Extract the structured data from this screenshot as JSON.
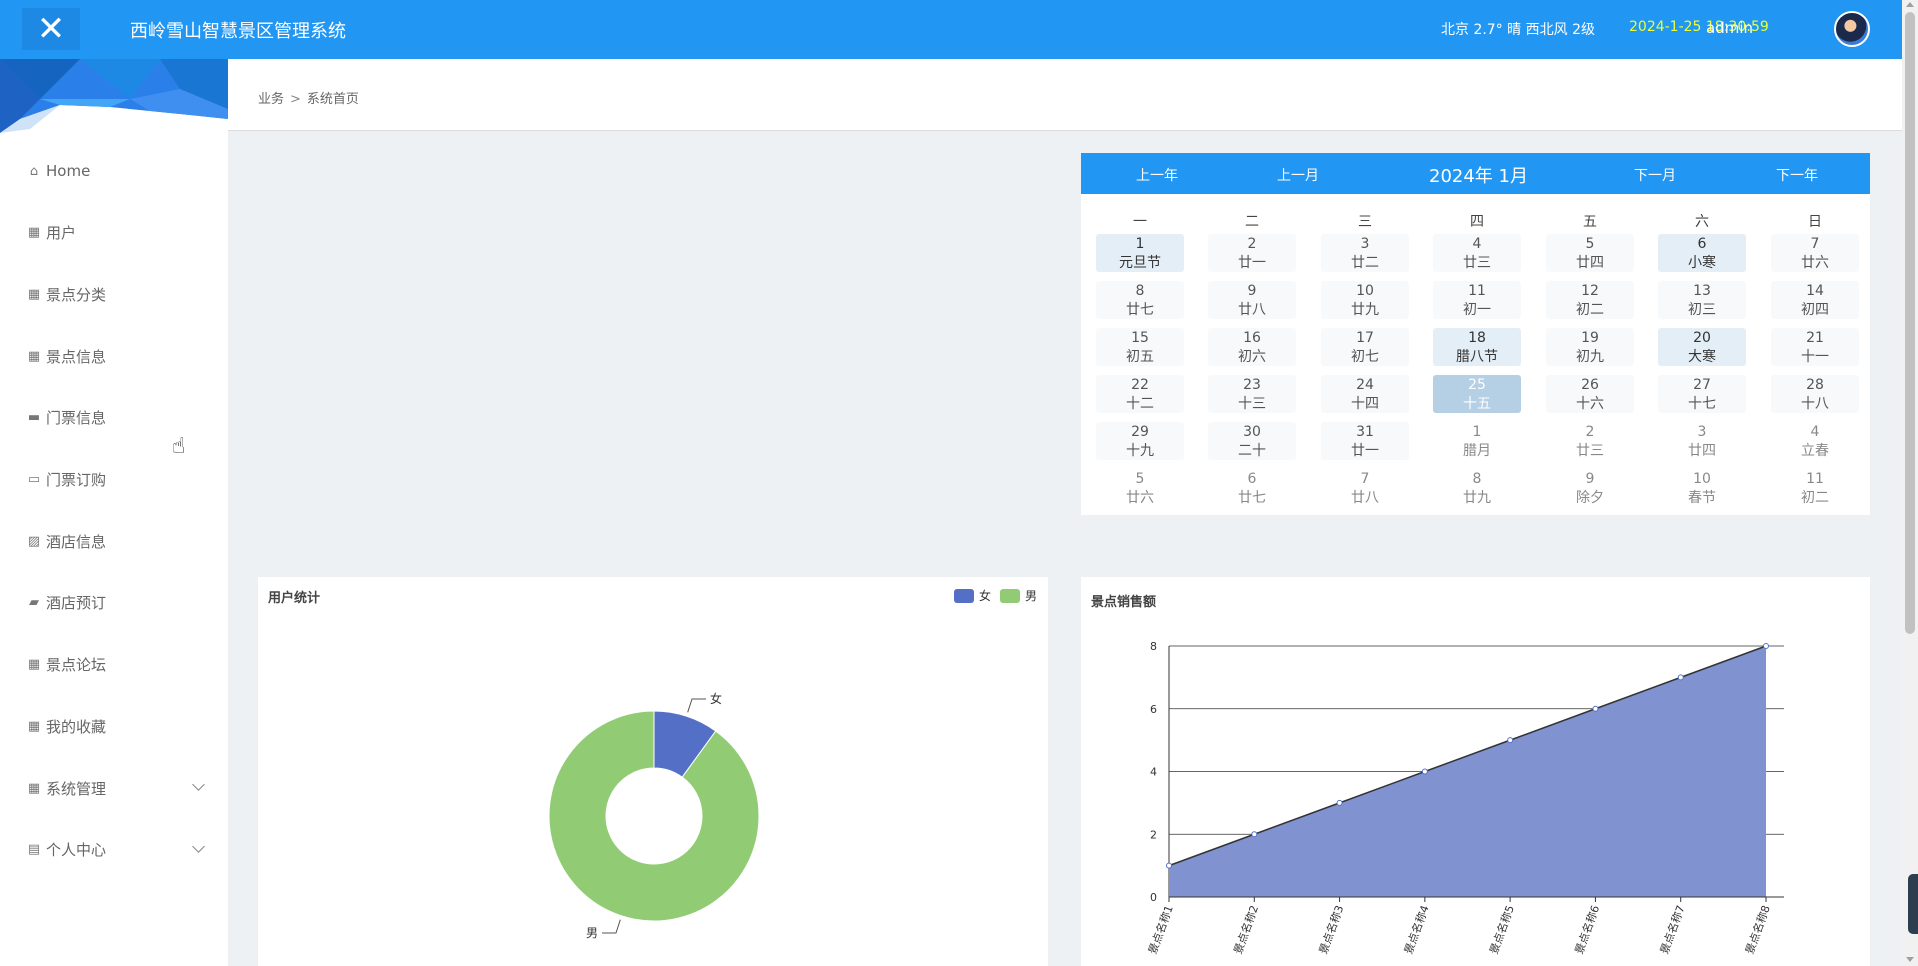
{
  "header": {
    "close_icon": "close-icon",
    "title": "西岭雪山智慧景区管理系统",
    "weather": "北京  2.7°  晴  西北风  2级",
    "datetime": "2024-1-25 18:30:59",
    "username": "admin",
    "colors": {
      "bar": "#2196f3",
      "datetime": "#e8ff3a"
    }
  },
  "sidebar": {
    "items": [
      {
        "label": "Home",
        "icon": "home-icon"
      },
      {
        "label": "用户",
        "icon": "grid-icon"
      },
      {
        "label": "景点分类",
        "icon": "grid-icon"
      },
      {
        "label": "景点信息",
        "icon": "grid-icon"
      },
      {
        "label": "门票信息",
        "icon": "briefcase-icon"
      },
      {
        "label": "门票订购",
        "icon": "bus-icon"
      },
      {
        "label": "酒店信息",
        "icon": "chart-icon"
      },
      {
        "label": "酒店预订",
        "icon": "camera-icon"
      },
      {
        "label": "景点论坛",
        "icon": "grid-icon"
      },
      {
        "label": "我的收藏",
        "icon": "grid-icon"
      },
      {
        "label": "系统管理",
        "icon": "grid-icon",
        "expandable": true
      },
      {
        "label": "个人中心",
        "icon": "card-icon",
        "expandable": true
      }
    ]
  },
  "breadcrumb": {
    "root": "业务",
    "separator": ">",
    "current": "系统首页"
  },
  "calendar": {
    "prev_year": "上一年",
    "prev_month": "上一月",
    "title": "2024年 1月",
    "next_month": "下一月",
    "next_year": "下一年",
    "weekdays": [
      "一",
      "二",
      "三",
      "四",
      "五",
      "六",
      "日"
    ],
    "days": [
      {
        "d": "1",
        "l": "元旦节",
        "s": "hl"
      },
      {
        "d": "2",
        "l": "廿一"
      },
      {
        "d": "3",
        "l": "廿二"
      },
      {
        "d": "4",
        "l": "廿三"
      },
      {
        "d": "5",
        "l": "廿四"
      },
      {
        "d": "6",
        "l": "小寒",
        "s": "hl"
      },
      {
        "d": "7",
        "l": "廿六"
      },
      {
        "d": "8",
        "l": "廿七"
      },
      {
        "d": "9",
        "l": "廿八"
      },
      {
        "d": "10",
        "l": "廿九"
      },
      {
        "d": "11",
        "l": "初一"
      },
      {
        "d": "12",
        "l": "初二"
      },
      {
        "d": "13",
        "l": "初三"
      },
      {
        "d": "14",
        "l": "初四"
      },
      {
        "d": "15",
        "l": "初五"
      },
      {
        "d": "16",
        "l": "初六"
      },
      {
        "d": "17",
        "l": "初七"
      },
      {
        "d": "18",
        "l": "腊八节",
        "s": "hl"
      },
      {
        "d": "19",
        "l": "初九"
      },
      {
        "d": "20",
        "l": "大寒",
        "s": "hl"
      },
      {
        "d": "21",
        "l": "十一"
      },
      {
        "d": "22",
        "l": "十二"
      },
      {
        "d": "23",
        "l": "十三"
      },
      {
        "d": "24",
        "l": "十四"
      },
      {
        "d": "25",
        "l": "十五",
        "s": "today"
      },
      {
        "d": "26",
        "l": "十六"
      },
      {
        "d": "27",
        "l": "十七"
      },
      {
        "d": "28",
        "l": "十八"
      },
      {
        "d": "29",
        "l": "十九"
      },
      {
        "d": "30",
        "l": "二十"
      },
      {
        "d": "31",
        "l": "廿一"
      },
      {
        "d": "1",
        "l": "腊月",
        "s": "other"
      },
      {
        "d": "2",
        "l": "廿三",
        "s": "other"
      },
      {
        "d": "3",
        "l": "廿四",
        "s": "other"
      },
      {
        "d": "4",
        "l": "立春",
        "s": "other"
      },
      {
        "d": "5",
        "l": "廿六",
        "s": "other"
      },
      {
        "d": "6",
        "l": "廿七",
        "s": "other"
      },
      {
        "d": "7",
        "l": "廿八",
        "s": "other"
      },
      {
        "d": "8",
        "l": "廿九",
        "s": "other"
      },
      {
        "d": "9",
        "l": "除夕",
        "s": "other"
      },
      {
        "d": "10",
        "l": "春节",
        "s": "other"
      },
      {
        "d": "11",
        "l": "初二",
        "s": "other"
      }
    ]
  },
  "user_stats": {
    "title": "用户统计",
    "legend": [
      "女",
      "男"
    ]
  },
  "sales": {
    "title": "景点销售额"
  },
  "chart_data": [
    {
      "type": "pie",
      "title": "用户统计",
      "categories": [
        "女",
        "男"
      ],
      "values": [
        1,
        9
      ],
      "colors": [
        "#5470c6",
        "#91cc75"
      ],
      "donut": true,
      "legend": "top-right"
    },
    {
      "type": "area",
      "title": "景点销售额",
      "categories": [
        "景点名称1",
        "景点名称2",
        "景点名称3",
        "景点名称4",
        "景点名称5",
        "景点名称6",
        "景点名称7",
        "景点名称8"
      ],
      "values": [
        1,
        2,
        3,
        4,
        5,
        6,
        7,
        8
      ],
      "ylim": [
        0,
        8
      ],
      "yticks": [
        0,
        2,
        4,
        6,
        8
      ],
      "grid": true,
      "colors": {
        "fill": "#8093d0",
        "line": "#333333"
      }
    }
  ]
}
